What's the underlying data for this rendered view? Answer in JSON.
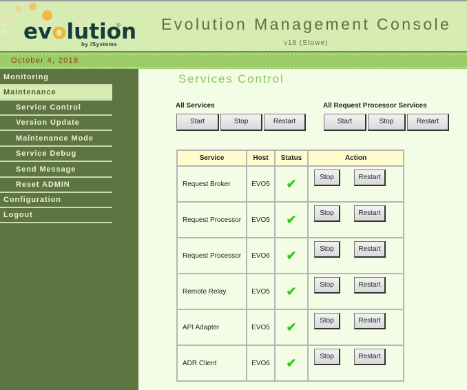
{
  "header": {
    "logo_text_pre": "ev",
    "logo_text_o": "o",
    "logo_text_post": "lution",
    "logo_registered": "®",
    "logo_byline": "by iSystems",
    "title": "Evolution Management Console",
    "version": "v18 (Stowe)"
  },
  "datebar": {
    "date": "October 4, 2018"
  },
  "sidebar": {
    "items": [
      {
        "label": "Monitoring",
        "level": "top",
        "active": false
      },
      {
        "label": "Maintenance",
        "level": "top",
        "active": true
      },
      {
        "label": "Service Control",
        "level": "sub",
        "active": false
      },
      {
        "label": "Version Update",
        "level": "sub",
        "active": false
      },
      {
        "label": "Maintenance Mode",
        "level": "sub",
        "active": false
      },
      {
        "label": "Service Debug",
        "level": "sub",
        "active": false
      },
      {
        "label": "Send Message",
        "level": "sub",
        "active": false
      },
      {
        "label": "Reset ADMIN",
        "level": "sub",
        "active": false
      },
      {
        "label": "Configuration",
        "level": "top",
        "active": false
      },
      {
        "label": "Logout",
        "level": "top",
        "active": false
      }
    ]
  },
  "main": {
    "title": "Services Control",
    "all_services": {
      "label": "All Services",
      "start": "Start",
      "stop": "Stop",
      "restart": "Restart"
    },
    "all_rp_services": {
      "label": "All Request Processor Services",
      "start": "Start",
      "stop": "Stop",
      "restart": "Restart"
    },
    "table": {
      "headers": [
        "Service",
        "Host",
        "Status",
        "Action"
      ],
      "rows": [
        {
          "service": "Request Broker",
          "host": "EVO5",
          "status": "running",
          "status_icon": "✔",
          "stop": "Stop",
          "restart": "Restart"
        },
        {
          "service": "Request Processor",
          "host": "EVO5",
          "status": "running",
          "status_icon": "✔",
          "stop": "Stop",
          "restart": "Restart"
        },
        {
          "service": "Request Processor",
          "host": "EVO6",
          "status": "running",
          "status_icon": "✔",
          "stop": "Stop",
          "restart": "Restart"
        },
        {
          "service": "Remote Relay",
          "host": "EVO5",
          "status": "running",
          "status_icon": "✔",
          "stop": "Stop",
          "restart": "Restart"
        },
        {
          "service": "API Adapter",
          "host": "EVO5",
          "status": "running",
          "status_icon": "✔",
          "stop": "Stop",
          "restart": "Restart"
        },
        {
          "service": "ADR Client",
          "host": "EVO6",
          "status": "running",
          "status_icon": "✔",
          "stop": "Stop",
          "restart": "Restart"
        }
      ]
    }
  },
  "colors": {
    "header_bg": "#d6ecb3",
    "datebar_bg": "#9bcc69",
    "sidebar_bg": "#5e7442",
    "main_bg": "#f3fde6",
    "title_green": "#8ec45e",
    "status_ok": "#2dcc1a",
    "table_header_bg": "#fffbcd",
    "date_text": "#8a3a0a"
  }
}
